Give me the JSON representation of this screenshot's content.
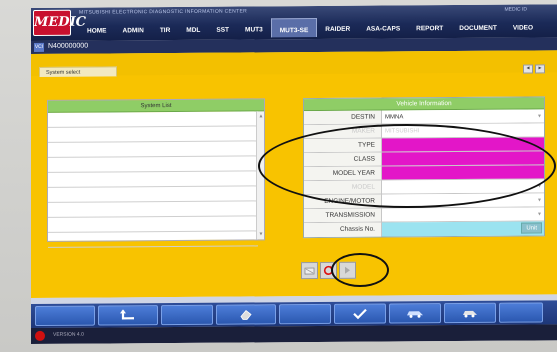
{
  "app": {
    "logo": "MEDIC",
    "brand_text": "MITSUBISHI ELECTRONIC DIAGNOSTIC INFORMATION CENTER",
    "sysinfo": "MEDIC ID"
  },
  "nav": {
    "tabs": [
      {
        "label": "HOME",
        "active": false
      },
      {
        "label": "ADMIN",
        "active": false
      },
      {
        "label": "TIR",
        "active": false
      },
      {
        "label": "MDL",
        "active": false
      },
      {
        "label": "SST",
        "active": false
      },
      {
        "label": "MUT3",
        "active": false
      },
      {
        "label": "MUT3-SE",
        "active": true
      },
      {
        "label": "RAIDER",
        "active": false
      },
      {
        "label": "ASA-CAPS",
        "active": false
      },
      {
        "label": "REPORT",
        "active": false
      },
      {
        "label": "DOCUMENT",
        "active": false
      },
      {
        "label": "VIDEO",
        "active": false
      }
    ]
  },
  "vehicle_id": "N400000000",
  "workspace": {
    "tab_label": "System select"
  },
  "system_list": {
    "header": "System List",
    "rows": [
      "",
      "",
      "",
      "",
      "",
      "",
      "",
      "",
      ""
    ]
  },
  "vehicle_info": {
    "header": "Vehicle Information",
    "rows": [
      {
        "label": "DESTIN",
        "value": "MMNA",
        "style": "normal",
        "dropdown": true
      },
      {
        "label": "MAKER",
        "value": "MITSUBISHI",
        "style": "dim",
        "dropdown": false
      },
      {
        "label": "TYPE",
        "value": "",
        "style": "magenta",
        "dropdown": false
      },
      {
        "label": "CLASS",
        "value": "",
        "style": "magenta",
        "dropdown": false
      },
      {
        "label": "MODEL YEAR",
        "value": "",
        "style": "magenta",
        "dropdown": false
      },
      {
        "label": "MODEL",
        "value": "",
        "style": "dimlabel",
        "dropdown": true
      },
      {
        "label": "ENGINE/MOTOR",
        "value": "",
        "style": "normal",
        "dropdown": true
      },
      {
        "label": "TRANSMISSION",
        "value": "",
        "style": "normal",
        "dropdown": true
      },
      {
        "label": "Chassis No.",
        "value": "",
        "style": "cyan",
        "dropdown": false
      }
    ],
    "unit_button": "Unit"
  },
  "actions": [
    "clear-icon",
    "reload-icon",
    "next-icon"
  ],
  "status": {
    "text": "VERSION 4.0"
  },
  "colors": {
    "workspace_yellow": "#f8c300",
    "header_green": "#8fcd66",
    "required_magenta": "#e316c8",
    "chassis_cyan": "#9be3f0"
  }
}
